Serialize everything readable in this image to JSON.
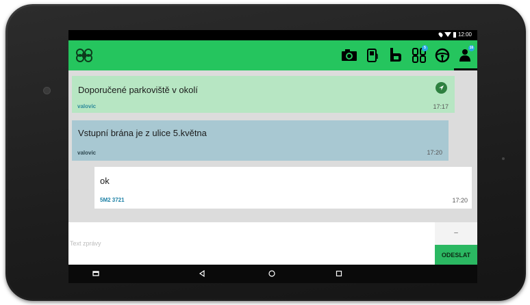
{
  "status_bar": {
    "time": "12:00"
  },
  "app_bar": {
    "logo_icon": "drone-logo-icon",
    "toolbar": [
      {
        "icon": "camera-icon",
        "badge": ""
      },
      {
        "icon": "fuel-pump-icon",
        "badge": ""
      },
      {
        "icon": "tow-icon",
        "badge": ""
      },
      {
        "icon": "grid-apps-icon",
        "badge": "5"
      },
      {
        "icon": "steering-wheel-icon",
        "badge": ""
      },
      {
        "icon": "driver-chat-icon",
        "badge": "16"
      }
    ]
  },
  "messages": [
    {
      "text": "Doporučené parkoviště v okolí",
      "author": "valovic",
      "time": "17:17"
    },
    {
      "text": "Vstupní brána je z ulice 5.května",
      "author": "valovic",
      "time": "17:20"
    },
    {
      "text": "ok",
      "author": "5M2 3721",
      "time": "17:20"
    }
  ],
  "composer": {
    "placeholder": "Text zprávy",
    "dash": "–",
    "send_label": "ODESLAT"
  },
  "colors": {
    "appbar": "#25c55e",
    "message_1": "#b7e6c3",
    "message_2": "#a8c8d2",
    "send": "#2bb862"
  }
}
